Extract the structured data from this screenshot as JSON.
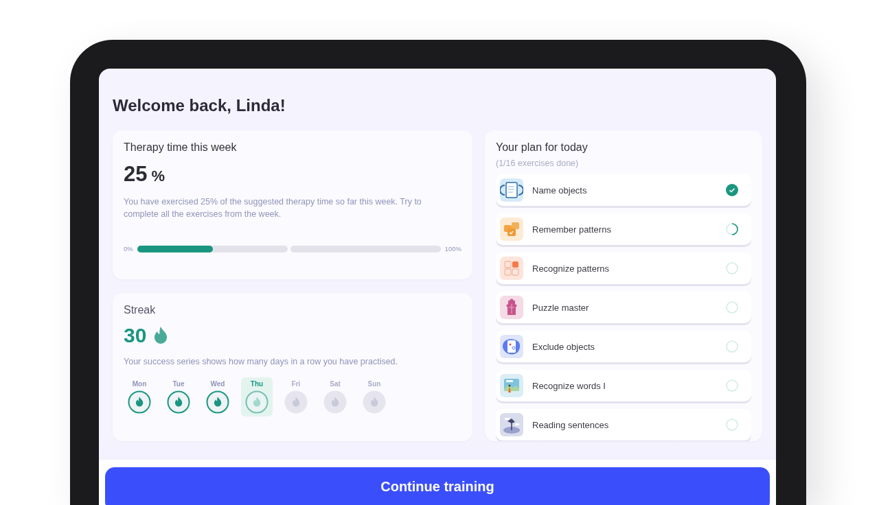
{
  "greeting": "Welcome back, Linda!",
  "therapy": {
    "title": "Therapy time this week",
    "value": "25",
    "unit": "%",
    "description": "You have exercised 25% of the suggested therapy time so far this week. Try to complete all the exercises from the week.",
    "level": 0.25,
    "min_label": "0%",
    "max_label": "100%"
  },
  "streak": {
    "title": "Streak",
    "count": "30",
    "description": "Your success series shows how many days in a row you have practised.",
    "days": [
      {
        "label": "Mon",
        "completed": true,
        "current": false
      },
      {
        "label": "Tue",
        "completed": true,
        "current": false
      },
      {
        "label": "Wed",
        "completed": true,
        "current": false
      },
      {
        "label": "Thu",
        "completed": false,
        "current": true
      },
      {
        "label": "Fri",
        "completed": false,
        "current": false
      },
      {
        "label": "Sat",
        "completed": false,
        "current": false
      },
      {
        "label": "Sun",
        "completed": false,
        "current": false
      }
    ]
  },
  "plan": {
    "title": "Your plan for today",
    "subtitle": "(1/16 exercises done)",
    "exercises": [
      {
        "name": "Name objects",
        "kind": "notebook",
        "completed": true,
        "in_progress": false
      },
      {
        "name": "Remember patterns",
        "kind": "cards",
        "completed": false,
        "in_progress": true
      },
      {
        "name": "Recognize patterns",
        "kind": "grid",
        "completed": false,
        "in_progress": false
      },
      {
        "name": "Puzzle master",
        "kind": "puzzle",
        "completed": false,
        "in_progress": false
      },
      {
        "name": "Exclude objects",
        "kind": "phone",
        "completed": false,
        "in_progress": false
      },
      {
        "name": "Recognize words I",
        "kind": "scene",
        "completed": false,
        "in_progress": false
      },
      {
        "name": "Reading sentences",
        "kind": "lamp",
        "completed": false,
        "in_progress": false
      }
    ]
  },
  "continue_button": "Continue training"
}
